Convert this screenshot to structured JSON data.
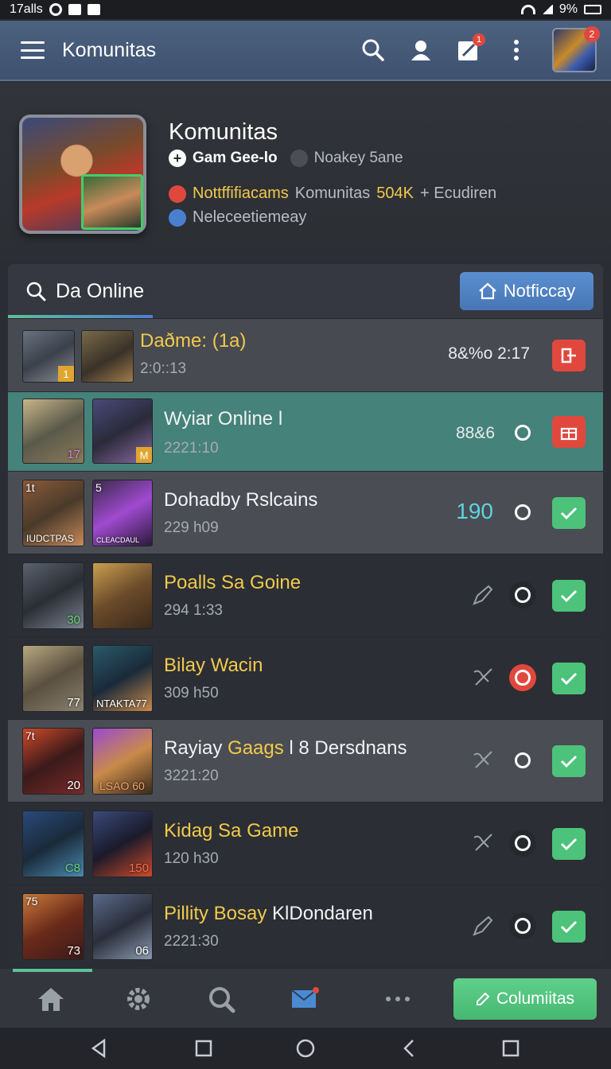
{
  "status_bar": {
    "left_text": "17alls",
    "right_text": "9%"
  },
  "app_bar": {
    "title": "Komunitas",
    "notif_badge": "1",
    "avatar_badge": "2"
  },
  "profile": {
    "name": "Komunitas",
    "line1_a": "Gam Gee-lo",
    "line1_b": "Noakey 5ane",
    "line2_a": "Nottffifiacams",
    "line2_b": "Komunitas",
    "line2_c": "504K",
    "line2_d": "+ Ecudiren",
    "line3": "Neleceetiemeay"
  },
  "panel": {
    "title": "Da Online",
    "notify_button": "Notficcay"
  },
  "rows": [
    {
      "title": "Daðme: (1a)",
      "time": "2:0::13",
      "value": "8&%o 2:17",
      "tag": "1"
    },
    {
      "title": "Wyiar Online l",
      "time": "2221:10",
      "value": "88&6",
      "num_a": "17",
      "tag_b": "M"
    },
    {
      "title": "Dohadby Rslcains",
      "time": "229 h09",
      "value": "190",
      "caption_a": "IUDCTPAS",
      "caption_b": "CLEACDAUL",
      "corner_a": "1t",
      "corner_b": "5"
    },
    {
      "title": "Poalls Sa Goine",
      "time": "294 1:33",
      "num_a": "30"
    },
    {
      "title": "Bilay Wacin",
      "time": "309 h50",
      "num_a": "77",
      "caption_b": "NTAKTA77"
    },
    {
      "title_a": "Rayiay ",
      "title_gold": "Gaags",
      "title_b": " l 8 Dersdnans",
      "time": "3221:20",
      "num_a": "20",
      "corner_a": "7t",
      "caption_b": "LSAO 60"
    },
    {
      "title": "Kidag Sa Game",
      "time": "120 h30",
      "num_a": "C8",
      "num_b": "150"
    },
    {
      "title_gold": "Pillity Bosay",
      "title_b": " KlDondaren",
      "time": "2221:30",
      "num_a": "73",
      "corner_a": "75",
      "num_b": "06"
    }
  ],
  "bottom_nav": {
    "button_label": "Columiitas"
  },
  "colors": {
    "accent_teal": "#458279",
    "accent_green": "#4cc27a",
    "accent_red": "#e0483e",
    "accent_blue": "#4a7fd0",
    "gold_text": "#f2c94c"
  }
}
